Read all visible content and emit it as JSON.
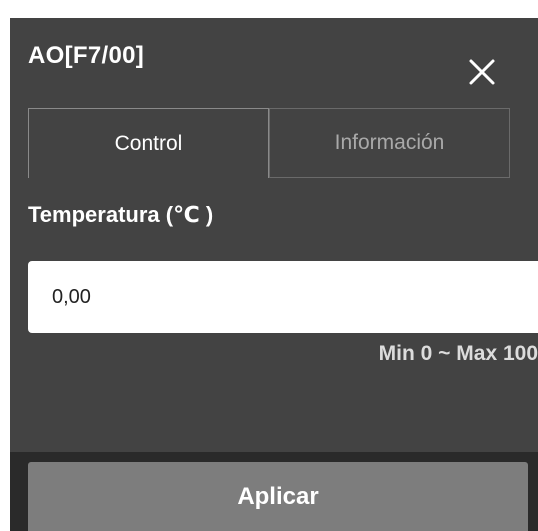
{
  "dialog": {
    "title": "AO[F7/00]",
    "close_icon": "close-icon"
  },
  "tabs": [
    {
      "label": "Control",
      "active": true
    },
    {
      "label": "Información",
      "active": false
    }
  ],
  "temperature": {
    "label": "Temperatura (℃ )",
    "value": "0,00",
    "range": "Min 0 ~ Max 100"
  },
  "actions": {
    "apply_label": "Aplicar"
  },
  "colors": {
    "panel_bg": "#434343",
    "footer_bg": "#2a2a2a",
    "button_bg": "#7d7d7d",
    "text": "#ffffff",
    "inactive_tab_text": "#a9a9a9"
  }
}
